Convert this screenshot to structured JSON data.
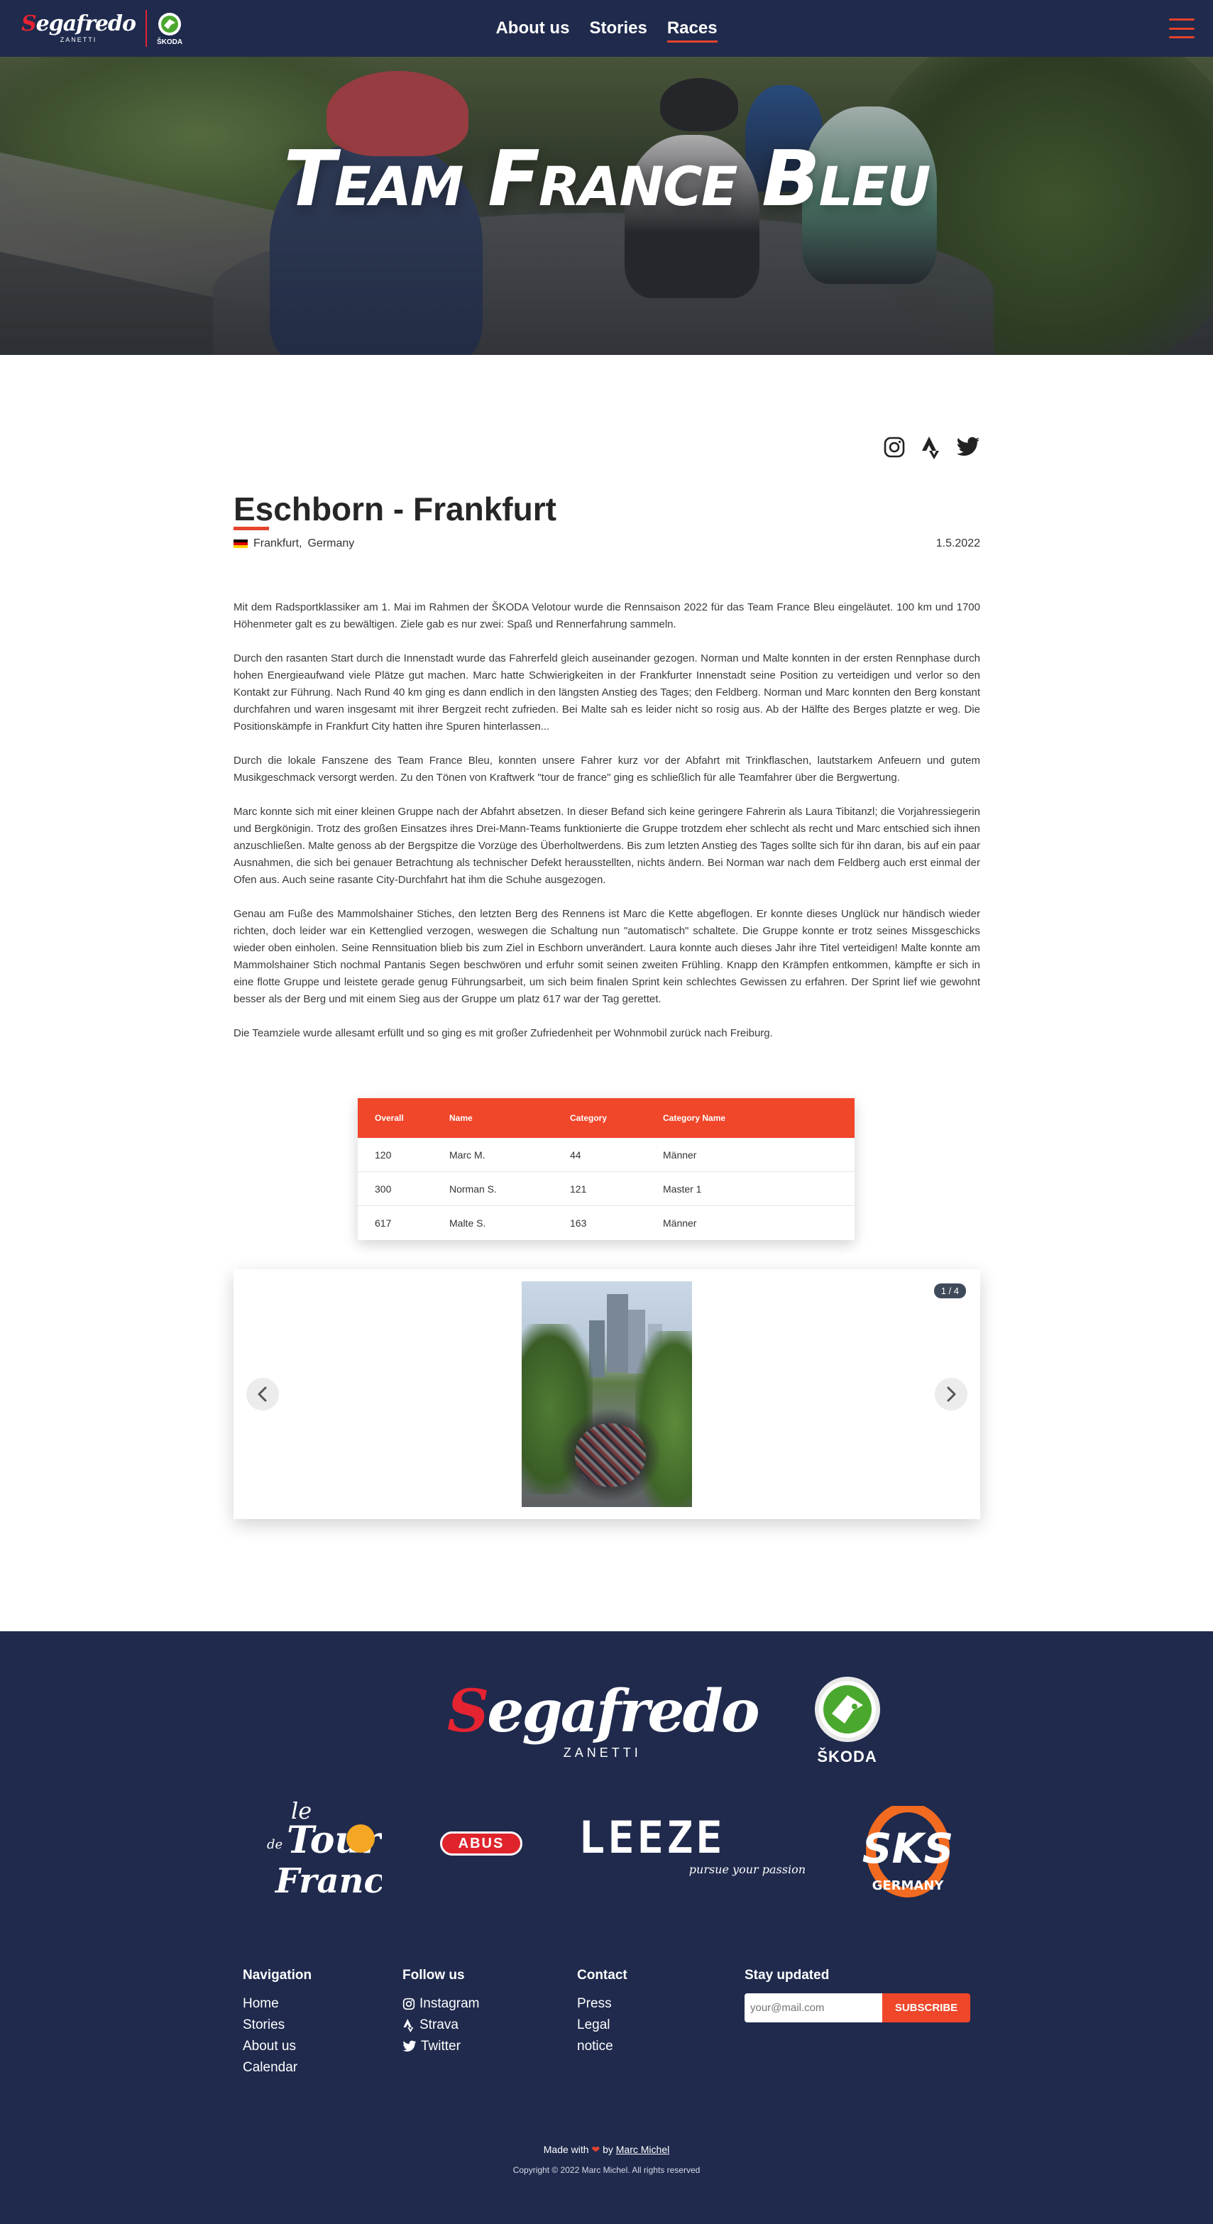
{
  "header": {
    "brand_segafredo": "Segafredo",
    "brand_segafredo_sub": "ZANETTI",
    "brand_skoda": "ŠKODA",
    "nav": [
      {
        "label": "About us",
        "active": false
      },
      {
        "label": "Stories",
        "active": false
      },
      {
        "label": "Races",
        "active": true
      }
    ]
  },
  "hero": {
    "title": "Team France Bleu"
  },
  "social": [
    "instagram-icon",
    "strava-icon",
    "twitter-icon"
  ],
  "article": {
    "title": "Eschborn - Frankfurt",
    "city": "Frankfurt,",
    "country": "Germany",
    "date": "1.5.2022",
    "paragraphs": [
      "Mit dem Radsportklassiker am 1. Mai im Rahmen der ŠKODA Velotour wurde die Rennsaison 2022 für das Team France Bleu eingeläutet. 100 km und 1700 Höhenmeter galt es zu bewältigen. Ziele gab es nur zwei: Spaß und Rennerfahrung sammeln.",
      "Durch den rasanten Start durch die Innenstadt wurde das Fahrerfeld gleich auseinander gezogen. Norman und Malte konnten in der ersten Rennphase durch hohen Energieaufwand viele Plätze gut machen. Marc hatte Schwierigkeiten in der Frankfurter Innenstadt seine Position zu verteidigen und verlor so den Kontakt zur Führung. Nach Rund 40 km ging es dann endlich in den längsten Anstieg des Tages; den Feldberg. Norman und Marc konnten den Berg konstant durchfahren und waren insgesamt mit ihrer Bergzeit recht zufrieden. Bei Malte sah es leider nicht so rosig aus. Ab der Hälfte des Berges platzte er weg. Die Positionskämpfe in Frankfurt City hatten ihre Spuren hinterlassen...",
      "Durch die lokale Fanszene des Team France Bleu, konnten unsere Fahrer kurz vor der Abfahrt mit Trinkflaschen, lautstarkem Anfeuern und gutem Musikgeschmack versorgt werden. Zu den Tönen von Kraftwerk \"tour de france\" ging es schließlich für alle Teamfahrer über die Bergwertung.",
      "Marc konnte sich mit einer kleinen Gruppe nach der Abfahrt absetzen. In dieser Befand sich keine geringere Fahrerin als Laura Tibitanzl; die Vorjahressiegerin und Bergkönigin. Trotz des großen Einsatzes ihres Drei-Mann-Teams funktionierte die Gruppe trotzdem eher schlecht als recht und Marc entschied sich ihnen anzuschließen. Malte genoss ab der Bergspitze die Vorzüge des Überholtwerdens. Bis zum letzten Anstieg des Tages sollte sich für ihn daran, bis auf ein paar Ausnahmen, die sich bei genauer Betrachtung als technischer Defekt herausstellten, nichts ändern. Bei Norman war nach dem Feldberg auch erst einmal der Ofen aus. Auch seine rasante City-Durchfahrt hat ihm die Schuhe ausgezogen.",
      "Genau am Fuße des Mammolshainer Stiches, den letzten Berg des Rennens ist Marc die Kette abgeflogen. Er konnte dieses Unglück nur händisch wieder richten, doch leider war ein Kettenglied verzogen, weswegen die Schaltung nun \"automatisch\" schaltete. Die Gruppe konnte er trotz seines Missgeschicks wieder oben einholen. Seine Rennsituation blieb bis zum Ziel in Eschborn unverändert. Laura konnte auch dieses Jahr ihre Titel verteidigen! Malte konnte am Mammolshainer Stich nochmal Pantanis Segen beschwören und erfuhr somit seinen zweiten Frühling. Knapp den Krämpfen entkommen, kämpfte er sich in eine flotte Gruppe und leistete gerade genug Führungsarbeit, um sich beim finalen Sprint kein schlechtes Gewissen zu erfahren. Der Sprint lief wie gewohnt besser als der Berg und mit einem Sieg aus der Gruppe um platz 617 war der Tag gerettet.",
      "Die Teamziele wurde allesamt erfüllt und so ging es mit großer Zufriedenheit per Wohnmobil zurück nach Freiburg."
    ]
  },
  "results": {
    "headers": [
      "Overall",
      "Name",
      "Category",
      "Category Name"
    ],
    "rows": [
      [
        "120",
        "Marc M.",
        "44",
        "Männer"
      ],
      [
        "300",
        "Norman S.",
        "121",
        "Master 1"
      ],
      [
        "617",
        "Malte S.",
        "163",
        "Männer"
      ]
    ]
  },
  "gallery": {
    "counter": "1 / 4"
  },
  "footer": {
    "segafredo": "Segafredo",
    "segafredo_sub": "ZANETTI",
    "skoda": "ŠKODA",
    "abus": "ABUS",
    "leeze": "LEEZE",
    "leeze_tag": "pursue your passion",
    "sks": "SKS",
    "sks_sub": "GERMANY",
    "navigation": {
      "heading": "Navigation",
      "items": [
        "Home",
        "Stories",
        "About us",
        "Calendar"
      ]
    },
    "follow": {
      "heading": "Follow us",
      "items": [
        "Instagram",
        "Strava",
        "Twitter"
      ]
    },
    "contact": {
      "heading": "Contact",
      "items": [
        "Press",
        "Legal notice"
      ]
    },
    "newsletter": {
      "heading": "Stay updated",
      "placeholder": "your@mail.com",
      "button": "SUBSCRIBE"
    },
    "made_prefix": "Made with",
    "made_by": "by",
    "author": "Marc Michel",
    "copyright": "Copyright © 2022 Marc Michel. All rights reserved"
  },
  "colors": {
    "navy": "#1f2a4d",
    "accent": "#f0462a",
    "brand_red": "#e52331"
  }
}
